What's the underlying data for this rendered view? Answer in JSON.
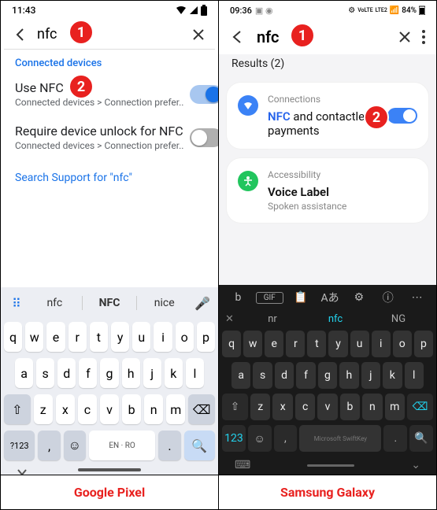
{
  "pixel": {
    "status": {
      "time": "11:43"
    },
    "search": {
      "query": "nfc"
    },
    "section": "Connected devices",
    "settings": [
      {
        "name": "Use NFC",
        "path": "Connected devices > Connection prefer..",
        "on": true
      },
      {
        "name": "Require device unlock for NFC",
        "path": "Connected devices > Connection prefer..",
        "on": false
      }
    ],
    "support": "Search Support for \"nfc\"",
    "keyboard": {
      "suggestions": [
        "nfc",
        "NFC",
        "nice"
      ],
      "row1": [
        "q",
        "w",
        "e",
        "r",
        "t",
        "y",
        "u",
        "i",
        "o",
        "p"
      ],
      "row2": [
        "a",
        "s",
        "d",
        "f",
        "g",
        "h",
        "j",
        "k",
        "l"
      ],
      "row3": [
        "z",
        "x",
        "c",
        "v",
        "b",
        "n",
        "m"
      ],
      "numkey": "?123",
      "space": "EN · RO"
    }
  },
  "samsung": {
    "status": {
      "time": "09:36",
      "battery": "84%"
    },
    "search": {
      "query": "nfc"
    },
    "results_label": "Results (2)",
    "cards": [
      {
        "category": "Connections",
        "title_prefix": "NFC",
        "title_rest": " and contactless payments",
        "toggle": true
      },
      {
        "category": "Accessibility",
        "title": "Voice Label",
        "sub": "Spoken assistance"
      }
    ],
    "keyboard": {
      "suggestions": [
        "nr",
        "nfc",
        "NG"
      ],
      "row1": [
        "q",
        "w",
        "e",
        "r",
        "t",
        "y",
        "u",
        "i",
        "o",
        "p"
      ],
      "row2": [
        "a",
        "s",
        "d",
        "f",
        "g",
        "h",
        "j",
        "k",
        "l"
      ],
      "row3": [
        "z",
        "x",
        "c",
        "v",
        "b",
        "n",
        "m"
      ],
      "numkey": "123",
      "space": "Microsoft SwiftKey"
    }
  },
  "badges": {
    "one": "1",
    "two": "2"
  },
  "captions": {
    "left": "Google Pixel",
    "right": "Samsung Galaxy"
  }
}
